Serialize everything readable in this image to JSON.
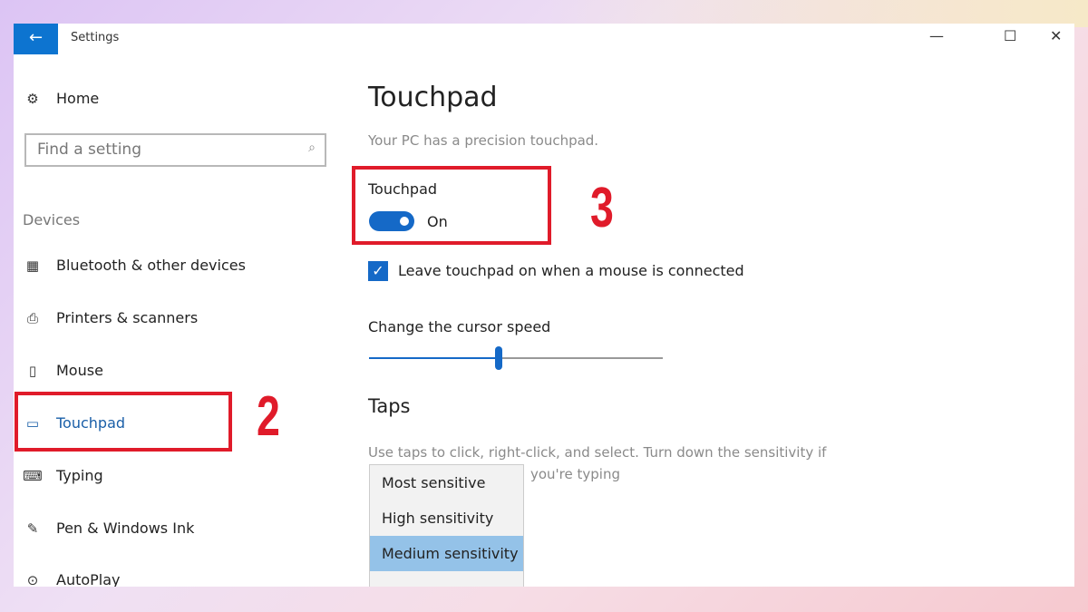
{
  "window": {
    "title": "Settings",
    "back_icon": "arrow-left-icon"
  },
  "sidebar": {
    "home": "Home",
    "search_placeholder": "Find a setting",
    "section": "Devices",
    "items": [
      {
        "label": "Bluetooth & other devices",
        "icon": "bluetooth-devices-icon"
      },
      {
        "label": "Printers & scanners",
        "icon": "printer-icon"
      },
      {
        "label": "Mouse",
        "icon": "mouse-icon"
      },
      {
        "label": "Touchpad",
        "icon": "touchpad-icon",
        "selected": true
      },
      {
        "label": "Typing",
        "icon": "keyboard-icon"
      },
      {
        "label": "Pen & Windows Ink",
        "icon": "pen-icon"
      },
      {
        "label": "AutoPlay",
        "icon": "autoplay-icon"
      }
    ]
  },
  "main": {
    "title": "Touchpad",
    "subtitle": "Your PC has a precision touchpad.",
    "toggle_label": "Touchpad",
    "toggle_state": "On",
    "checkbox_label": "Leave touchpad on when a mouse is connected",
    "checkbox_checked": true,
    "cursor_speed_label": "Change the cursor speed",
    "cursor_speed_percent": 44,
    "taps_heading": "Taps",
    "taps_desc1": "Use taps to click, right-click, and select. Turn down the sensitivity if",
    "taps_desc2": "you're typing",
    "sensitivity_options": [
      "Most sensitive",
      "High sensitivity",
      "Medium sensitivity"
    ],
    "selected_sensitivity": "Medium sensitivity"
  },
  "annotations": {
    "step2": "2",
    "step3": "3",
    "color": "#e01b2a"
  },
  "accent": "#1569c7"
}
